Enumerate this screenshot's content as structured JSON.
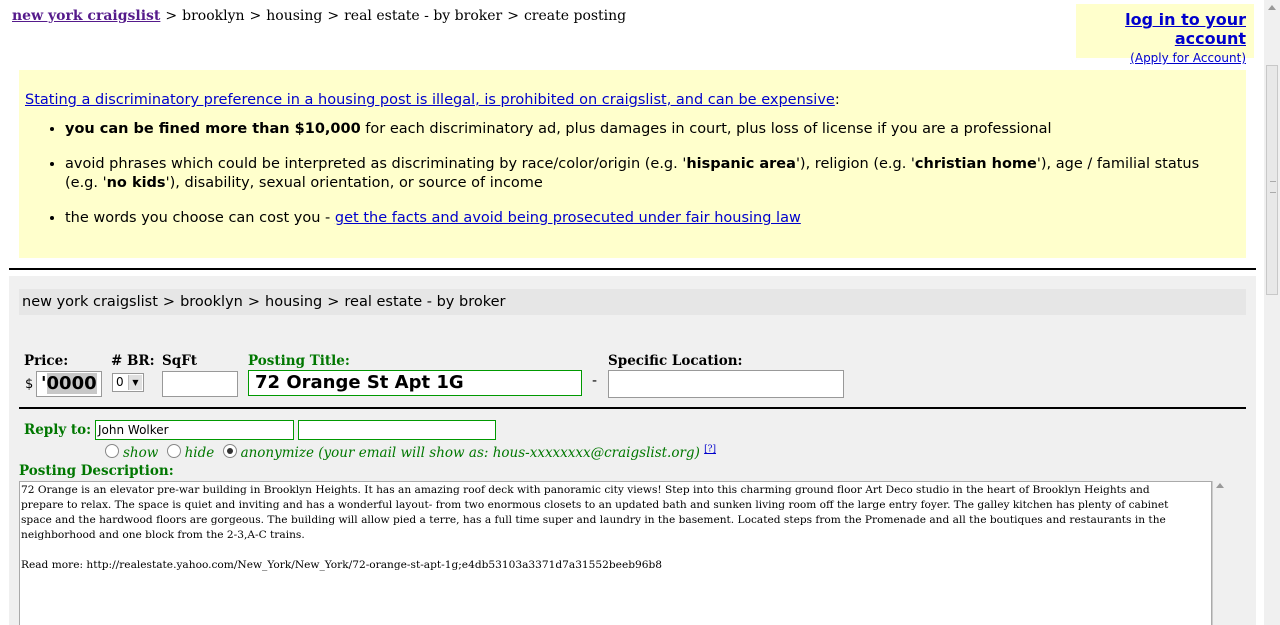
{
  "breadcrumb": {
    "home": "new york craigslist",
    "items": [
      "brooklyn",
      "housing",
      "real estate - by broker",
      "create posting"
    ]
  },
  "login": {
    "login_label": "log in to your account",
    "apply_label": "(Apply for Account)"
  },
  "warning": {
    "lead_link": "Stating a discriminatory preference in a housing post is illegal, is prohibited on craigslist, and can be expensive",
    "lead_tail": ":",
    "b1_bold": "you can be fined more than $10,000",
    "b1_rest": " for each discriminatory ad, plus damages in court, plus loss of license if you are a professional",
    "b2_a": "avoid phrases which could be interpreted as discriminating by race/color/origin (e.g. '",
    "b2_b": "hispanic area",
    "b2_c": "'), religion (e.g. '",
    "b2_d": "christian home",
    "b2_e": "'), age / familial status (e.g. '",
    "b2_f": "no kids",
    "b2_g": "'), disability, sexual orientation, or source of income",
    "b3_text": "the words you choose can cost you - ",
    "b3_link": "get the facts and avoid being prosecuted under fair housing law"
  },
  "form": {
    "crumb": [
      "new york craigslist",
      "brooklyn",
      "housing",
      "real estate - by broker"
    ],
    "price_label": "Price:",
    "currency": "$",
    "price_value_pre": "'",
    "price_value_hl": "0000",
    "br_label": "# BR:",
    "br_value": "0",
    "sqft_label": "SqFt",
    "title_label": "Posting Title:",
    "title_value": "72 Orange St Apt 1G",
    "dash": "-",
    "location_label": "Specific Location:",
    "reply_label": "Reply to:",
    "reply_name": "John Wolker",
    "opt_show": "show",
    "opt_hide": "hide",
    "opt_anon": "anonymize (your email will show as: hous-xxxxxxxx@craigslist.org)",
    "help_ref": "[?]",
    "desc_label": "Posting Description:",
    "desc_p1": "72 Orange is an elevator pre-war building in Brooklyn Heights. It has an amazing roof deck with panoramic city views! Step into this charming ground floor Art Deco studio in the heart of Brooklyn Heights and prepare to relax. The space is quiet and inviting and has a wonderful layout- from two enormous closets to an updated bath and sunken living room off the large entry foyer. The galley kitchen has plenty of cabinet space and the hardwood floors are gorgeous. The building will allow pied a terre, has a full time super and laundry in the basement. Located steps from the Promenade and all the boutiques and restaurants in the neighborhood and one block from the 2-3,A-C trains.",
    "desc_p2": "Read more: http://realestate.yahoo.com/New_York/New_York/72-orange-st-apt-1g;e4db53103a3371d7a31552beeb96b8"
  },
  "colors": {
    "highlight_bg": "#ffffcc",
    "link": "#0000cc",
    "visited": "#551a8b",
    "green_label": "#007700"
  }
}
